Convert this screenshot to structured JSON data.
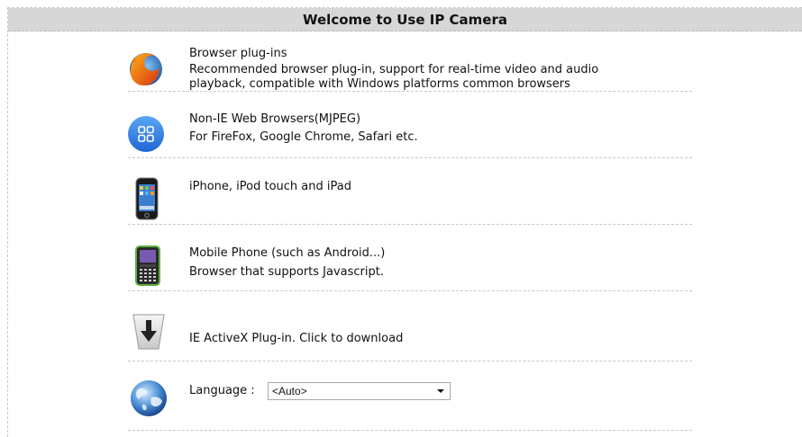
{
  "header": {
    "title": "Welcome to Use IP Camera"
  },
  "items": [
    {
      "icon": "firefox-icon",
      "title": "Browser plug-ins",
      "desc": "Recommended browser plug-in, support for real-time video and audio",
      "desc2": "playback, compatible with Windows platforms common browsers"
    },
    {
      "icon": "grid-apps-icon",
      "title": "Non-IE Web Browsers(MJPEG)",
      "desc": "For FireFox, Google Chrome, Safari etc."
    },
    {
      "icon": "iphone-icon",
      "title": "iPhone, iPod touch and iPad"
    },
    {
      "icon": "mobile-phone-icon",
      "title": "Mobile Phone (such as Android...)",
      "desc": "Browser that supports Javascript."
    },
    {
      "icon": "download-arrow-icon",
      "title": "IE ActiveX Plug-in. Click to download"
    }
  ],
  "language": {
    "label": "Language :",
    "selected": "<Auto>",
    "icon": "globe-icon"
  },
  "colors": {
    "header_bg": "#d7d7d7",
    "blue_icon": "#2f7ae0",
    "separator": "#c8c8c8"
  }
}
